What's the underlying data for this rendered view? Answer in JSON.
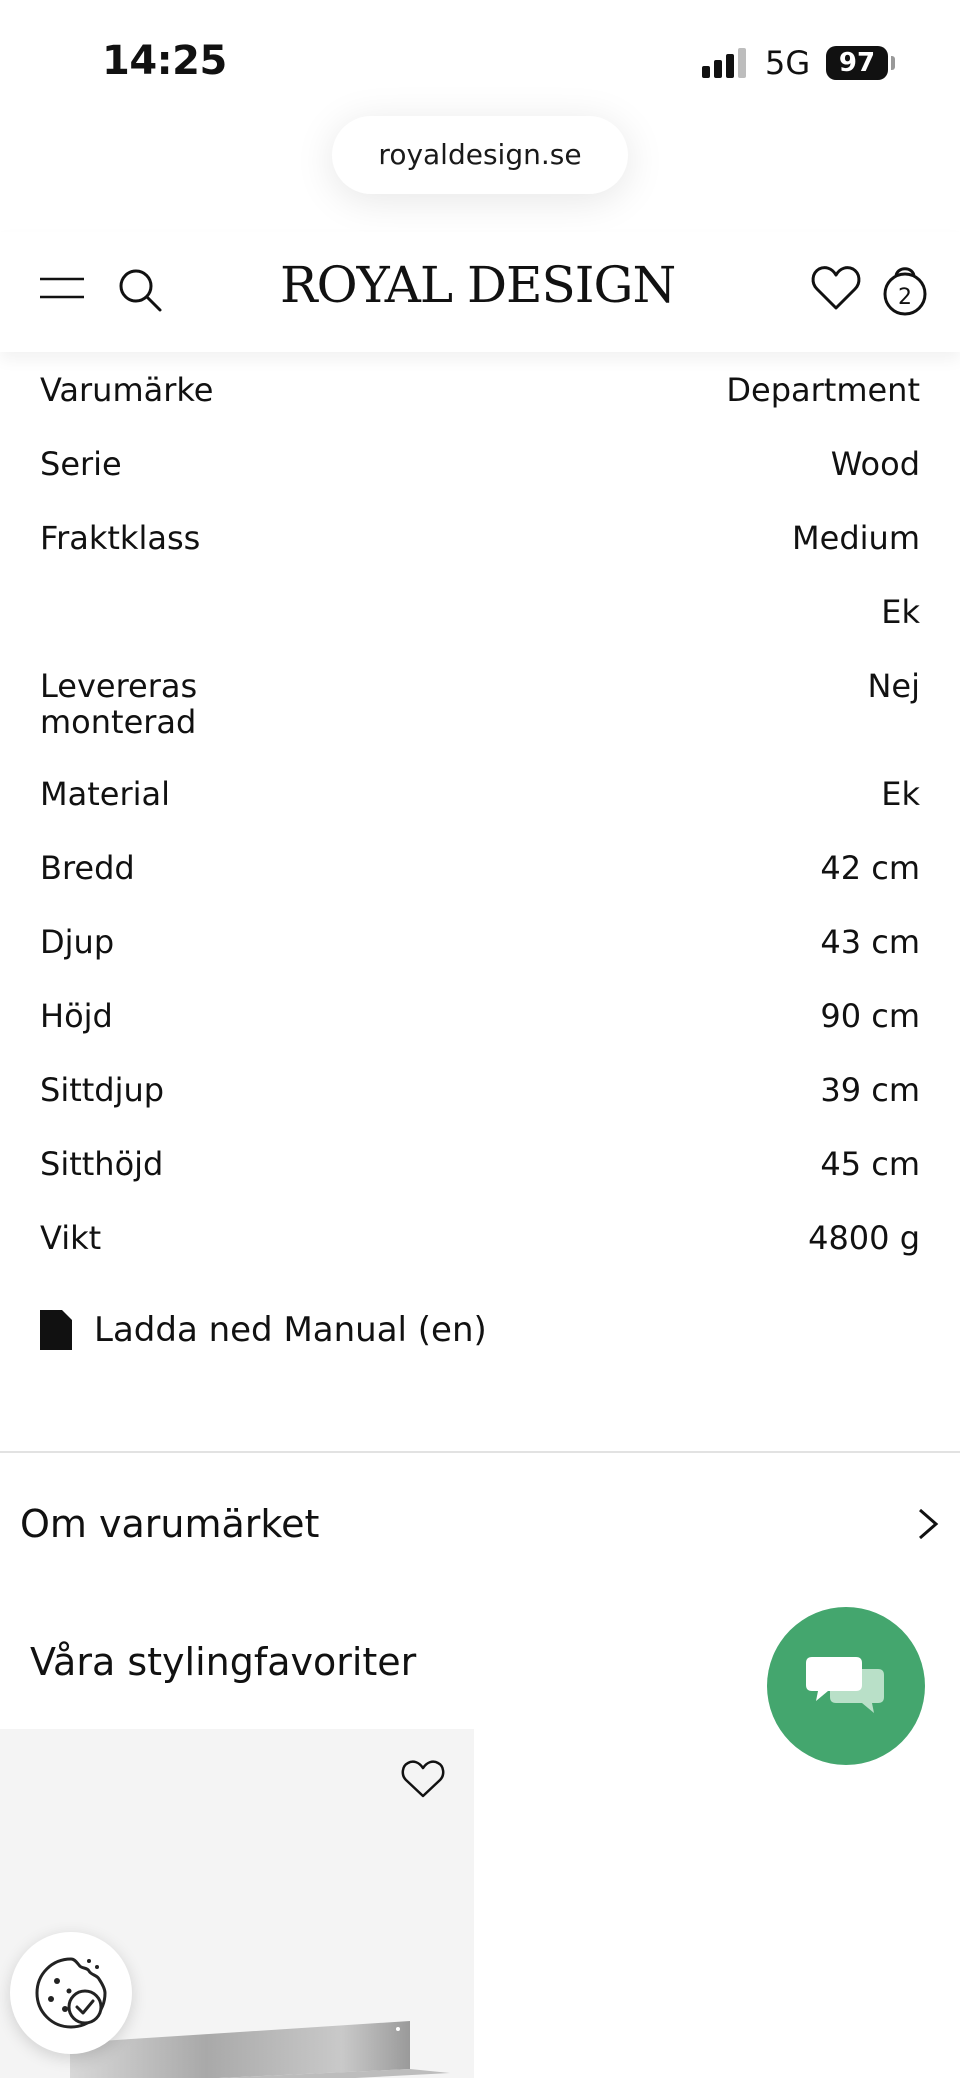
{
  "status_bar": {
    "time": "14:25",
    "network": "5G",
    "battery": "97"
  },
  "browser": {
    "url": "royaldesign.se"
  },
  "header": {
    "logo": "ROYAL DESIGN",
    "cart_count": "2"
  },
  "specs": [
    {
      "label": "Varumärke",
      "value": "Department"
    },
    {
      "label": "Serie",
      "value": "Wood"
    },
    {
      "label": "Fraktklass",
      "value": "Medium"
    },
    {
      "label": "",
      "value": "Ek"
    },
    {
      "label": "Levereras monterad",
      "value": "Nej"
    },
    {
      "label": "Material",
      "value": "Ek"
    },
    {
      "label": "Bredd",
      "value": "42 cm"
    },
    {
      "label": "Djup",
      "value": "43 cm"
    },
    {
      "label": "Höjd",
      "value": "90 cm"
    },
    {
      "label": "Sittdjup",
      "value": "39 cm"
    },
    {
      "label": "Sitthöjd",
      "value": "45 cm"
    },
    {
      "label": "Vikt",
      "value": "4800 g"
    }
  ],
  "download": {
    "label": "Ladda ned Manual (en)"
  },
  "brand_section": {
    "label": "Om varumärket"
  },
  "styling": {
    "title": "Våra stylingfavoriter"
  },
  "colors": {
    "chat_green": "#44a66e",
    "card_bg": "#f4f4f4"
  },
  "icons": [
    "signal-icon",
    "battery-icon",
    "menu-icon",
    "search-icon",
    "heart-icon",
    "bag-icon",
    "document-icon",
    "chevron-right-icon",
    "chat-icon",
    "cookie-icon"
  ]
}
